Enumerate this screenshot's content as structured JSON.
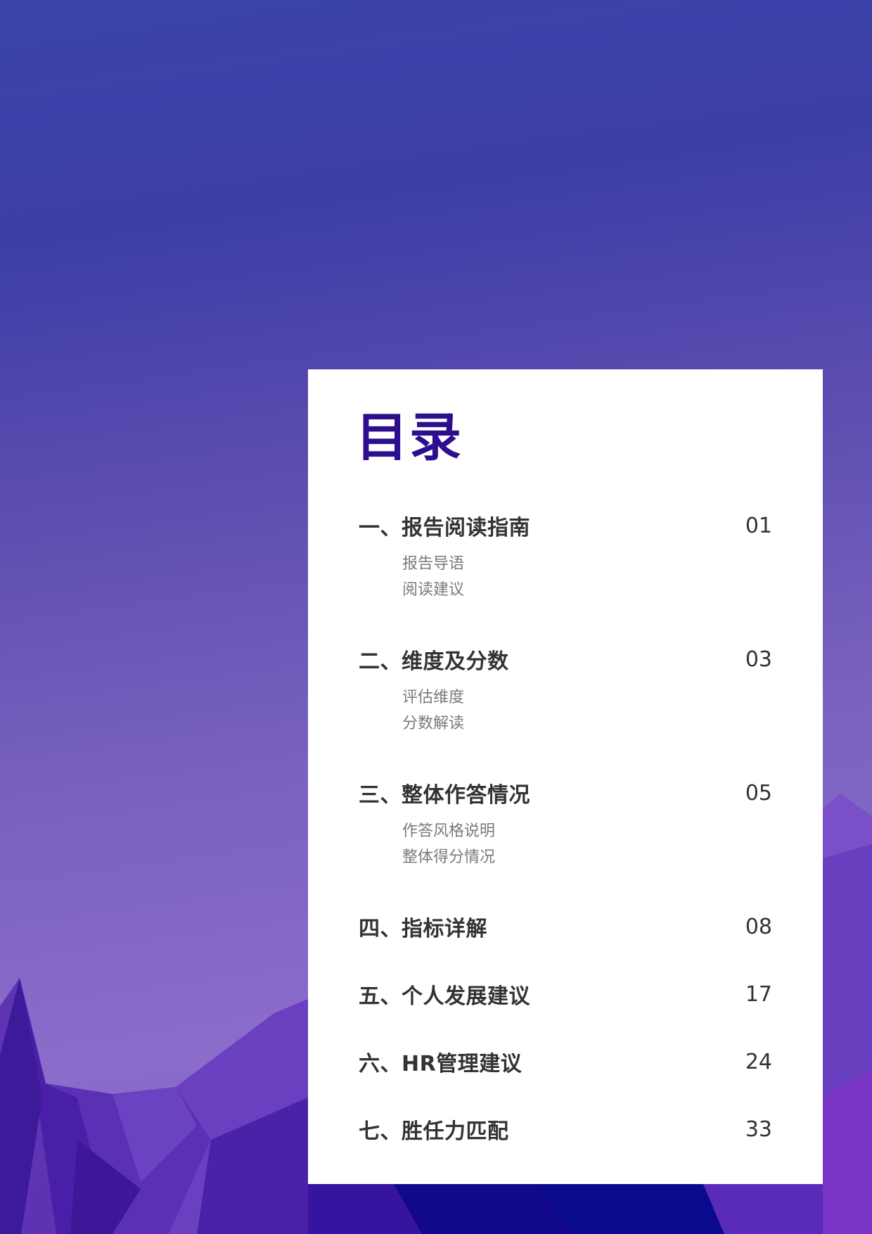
{
  "toc": {
    "title": "目录",
    "sections": [
      {
        "title": "一、报告阅读指南",
        "page": "01",
        "subs": [
          "报告导语",
          "阅读建议"
        ]
      },
      {
        "title": "二、维度及分数",
        "page": "03",
        "subs": [
          "评估维度",
          "分数解读"
        ]
      },
      {
        "title": "三、整体作答情况",
        "page": "05",
        "subs": [
          "作答风格说明",
          "整体得分情况"
        ]
      },
      {
        "title": "四、指标详解",
        "page": "08",
        "subs": []
      },
      {
        "title": "五、个人发展建议",
        "page": "17",
        "subs": []
      },
      {
        "title": "六、HR管理建议",
        "page": "24",
        "subs": []
      },
      {
        "title": "七、胜任力匹配",
        "page": "33",
        "subs": []
      }
    ]
  },
  "colors": {
    "title": "#2c0e8e",
    "section_text": "#333333",
    "sub_text": "#7a7a7a",
    "card_bg": "#ffffff"
  }
}
